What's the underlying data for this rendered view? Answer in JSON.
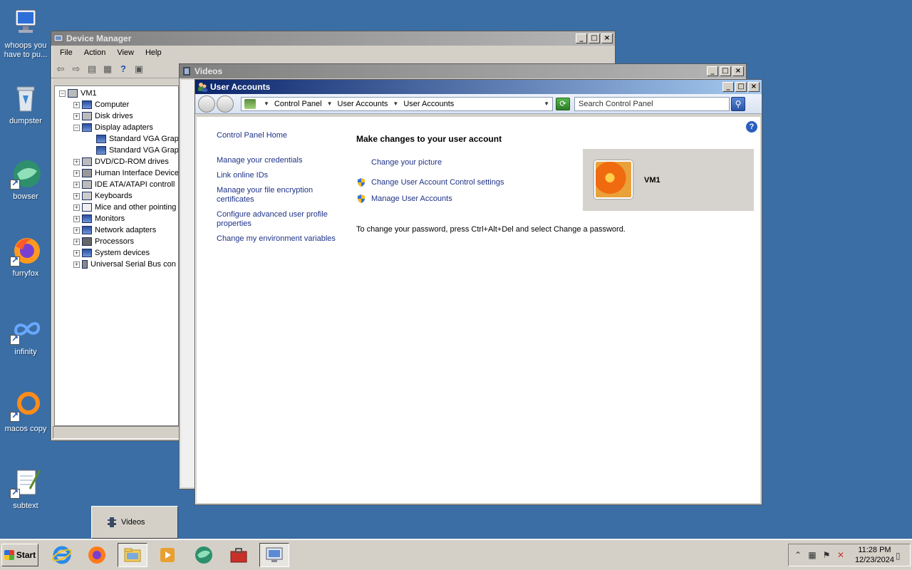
{
  "desktop": {
    "icons": [
      {
        "label": "whoops you have to pu..."
      },
      {
        "label": "dumpster"
      },
      {
        "label": "bowser"
      },
      {
        "label": "furryfox"
      },
      {
        "label": "infinity"
      },
      {
        "label": "macos copy"
      },
      {
        "label": "subtext"
      }
    ]
  },
  "device_manager": {
    "title": "Device Manager",
    "menu": [
      "File",
      "Action",
      "View",
      "Help"
    ],
    "tree": {
      "root": "VM1",
      "items": [
        "Computer",
        "Disk drives",
        "Display adapters",
        "Standard VGA Grap",
        "Standard VGA Grap",
        "DVD/CD-ROM drives",
        "Human Interface Device",
        "IDE ATA/ATAPI controll",
        "Keyboards",
        "Mice and other pointing",
        "Monitors",
        "Network adapters",
        "Processors",
        "System devices",
        "Universal Serial Bus con"
      ]
    }
  },
  "videos": {
    "title": "Videos"
  },
  "user_accounts": {
    "title": "User Accounts",
    "breadcrumb": [
      "Control Panel",
      "User Accounts",
      "User Accounts"
    ],
    "search_placeholder": "Search Control Panel",
    "left_links": [
      "Control Panel Home",
      "Manage your credentials",
      "Link online IDs",
      "Manage your file encryption certificates",
      "Configure advanced user profile properties",
      "Change my environment variables"
    ],
    "heading": "Make changes to your user account",
    "tasks": [
      "Change your picture",
      "Change User Account Control settings",
      "Manage User Accounts"
    ],
    "user_name": "VM1",
    "note": "To change your password, press Ctrl+Alt+Del and select Change a password."
  },
  "thumbnail": {
    "label": "Videos"
  },
  "taskbar": {
    "start_label": "Start",
    "time": "11:28 PM",
    "date": "12/23/2024"
  }
}
